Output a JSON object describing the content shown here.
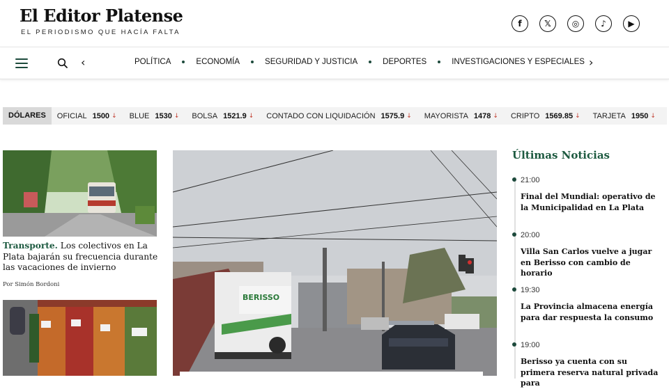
{
  "header": {
    "logo": "El Editor Platense",
    "tagline": "EL PERIODISMO QUE HACÍA FALTA",
    "socials": [
      {
        "name": "facebook-icon",
        "glyph": "f"
      },
      {
        "name": "x-icon",
        "glyph": "𝕏"
      },
      {
        "name": "instagram-icon",
        "glyph": "◎"
      },
      {
        "name": "tiktok-icon",
        "glyph": "♪"
      },
      {
        "name": "youtube-icon",
        "glyph": "▶"
      }
    ]
  },
  "nav": {
    "items": [
      "POLÍTICA",
      "ECONOMÍA",
      "SEGURIDAD Y JUSTICIA",
      "DEPORTES",
      "INVESTIGACIONES Y ESPECIALES"
    ],
    "prev_glyph": "‹",
    "next_glyph": "›"
  },
  "currency": {
    "label": "DÓLARES",
    "arrow": "↓",
    "items": [
      {
        "name": "OFICIAL",
        "value": "1500"
      },
      {
        "name": "BLUE",
        "value": "1530"
      },
      {
        "name": "BOLSA",
        "value": "1521.9"
      },
      {
        "name": "CONTADO CON LIQUIDACIÓN",
        "value": "1575.9"
      },
      {
        "name": "MAYORISTA",
        "value": "1478"
      },
      {
        "name": "CRIPTO",
        "value": "1569.85"
      },
      {
        "name": "TARJETA",
        "value": "1950"
      }
    ]
  },
  "left": {
    "article1": {
      "kicker": "Transporte.",
      "headline": "Los colectivos en La Plata bajarán su frecuencia durante las vacaciones de invierno",
      "byline": "Por Simón Bordoni"
    },
    "truck_sign": "BERISSO"
  },
  "latest": {
    "title": "Últimas Noticias",
    "items": [
      {
        "time": "21:00",
        "headline": "Final del Mundial: operativo de la Municipalidad en La Plata"
      },
      {
        "time": "20:00",
        "headline": "Villa San Carlos vuelve a jugar en Berisso con cambio de horario"
      },
      {
        "time": "19:30",
        "headline": "La Provincia almacena energía para dar respuesta la consumo"
      },
      {
        "time": "19:00",
        "headline": "Berisso ya cuenta con su primera reserva natural privada para"
      }
    ]
  },
  "colors": {
    "accent_green": "#1d5a40",
    "down_arrow": "#c0392b"
  }
}
